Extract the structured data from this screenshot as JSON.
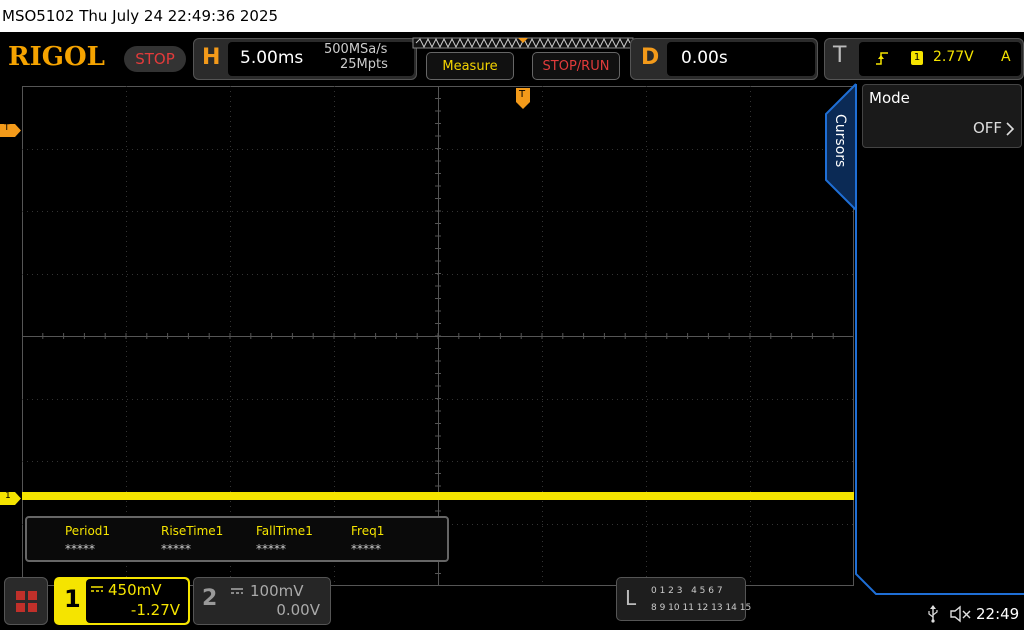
{
  "titlebar": {
    "text": "MSO5102  Thu July 24 22:49:36 2025"
  },
  "brand": {
    "logo": "RIGOL",
    "run_state": "STOP"
  },
  "horizontal": {
    "letter": "H",
    "timebase": "5.00ms",
    "sample_rate": "500MSa/s",
    "memory_depth": "25Mpts"
  },
  "buttons": {
    "measure": "Measure",
    "stop_run": "STOP/RUN"
  },
  "delay": {
    "letter": "D",
    "value": "0.00s"
  },
  "trigger": {
    "letter": "T",
    "source": "1",
    "level": "2.77V",
    "mode": "A"
  },
  "markers": {
    "trigger_level": "T",
    "ch1_offset": "1",
    "trigger_position": "T"
  },
  "cursors": {
    "tab_label": "Cursors",
    "mode_label": "Mode",
    "mode_value": "OFF"
  },
  "measurements": {
    "items": [
      {
        "label": "Period1",
        "value": "*****"
      },
      {
        "label": "RiseTime1",
        "value": "*****"
      },
      {
        "label": "FallTime1",
        "value": "*****"
      },
      {
        "label": "Freq1",
        "value": "*****"
      }
    ]
  },
  "channel1": {
    "number": "1",
    "scale": "450mV",
    "offset": "-1.27V"
  },
  "channel2": {
    "number": "2",
    "scale": "100mV",
    "offset": "0.00V"
  },
  "logic": {
    "letter": "L",
    "row1": "0 1 2 3   4 5 6 7",
    "row2": "8 9 10 11 12 13 14 15"
  },
  "statusbar": {
    "time": "22:49"
  },
  "colors": {
    "ch1": "#f5e400",
    "accent": "#f39a1a",
    "panel_blue": "#1f6fd6",
    "stop_red": "#e23b3b"
  }
}
